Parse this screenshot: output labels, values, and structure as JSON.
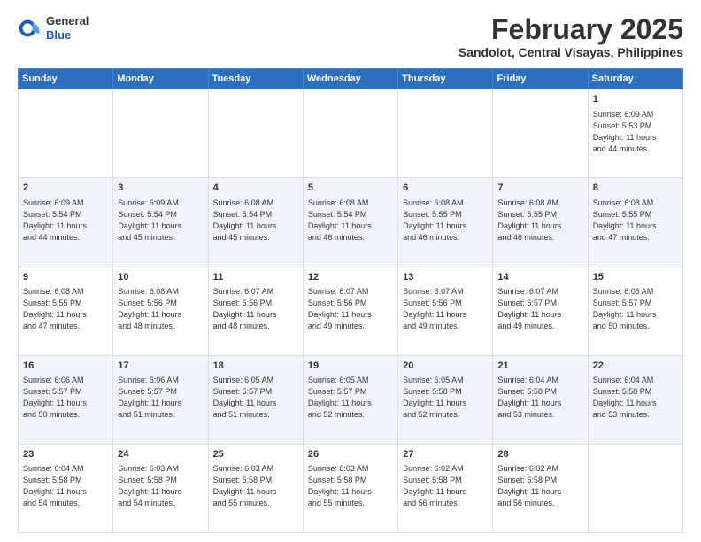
{
  "header": {
    "logo_general": "General",
    "logo_blue": "Blue",
    "month_title": "February 2025",
    "location": "Sandolot, Central Visayas, Philippines"
  },
  "days_of_week": [
    "Sunday",
    "Monday",
    "Tuesday",
    "Wednesday",
    "Thursday",
    "Friday",
    "Saturday"
  ],
  "weeks": [
    [
      {
        "day": "",
        "info": ""
      },
      {
        "day": "",
        "info": ""
      },
      {
        "day": "",
        "info": ""
      },
      {
        "day": "",
        "info": ""
      },
      {
        "day": "",
        "info": ""
      },
      {
        "day": "",
        "info": ""
      },
      {
        "day": "1",
        "info": "Sunrise: 6:09 AM\nSunset: 5:53 PM\nDaylight: 11 hours\nand 44 minutes."
      }
    ],
    [
      {
        "day": "2",
        "info": "Sunrise: 6:09 AM\nSunset: 5:54 PM\nDaylight: 11 hours\nand 44 minutes."
      },
      {
        "day": "3",
        "info": "Sunrise: 6:09 AM\nSunset: 5:54 PM\nDaylight: 11 hours\nand 45 minutes."
      },
      {
        "day": "4",
        "info": "Sunrise: 6:08 AM\nSunset: 5:54 PM\nDaylight: 11 hours\nand 45 minutes."
      },
      {
        "day": "5",
        "info": "Sunrise: 6:08 AM\nSunset: 5:54 PM\nDaylight: 11 hours\nand 46 minutes."
      },
      {
        "day": "6",
        "info": "Sunrise: 6:08 AM\nSunset: 5:55 PM\nDaylight: 11 hours\nand 46 minutes."
      },
      {
        "day": "7",
        "info": "Sunrise: 6:08 AM\nSunset: 5:55 PM\nDaylight: 11 hours\nand 46 minutes."
      },
      {
        "day": "8",
        "info": "Sunrise: 6:08 AM\nSunset: 5:55 PM\nDaylight: 11 hours\nand 47 minutes."
      }
    ],
    [
      {
        "day": "9",
        "info": "Sunrise: 6:08 AM\nSunset: 5:55 PM\nDaylight: 11 hours\nand 47 minutes."
      },
      {
        "day": "10",
        "info": "Sunrise: 6:08 AM\nSunset: 5:56 PM\nDaylight: 11 hours\nand 48 minutes."
      },
      {
        "day": "11",
        "info": "Sunrise: 6:07 AM\nSunset: 5:56 PM\nDaylight: 11 hours\nand 48 minutes."
      },
      {
        "day": "12",
        "info": "Sunrise: 6:07 AM\nSunset: 5:56 PM\nDaylight: 11 hours\nand 49 minutes."
      },
      {
        "day": "13",
        "info": "Sunrise: 6:07 AM\nSunset: 5:56 PM\nDaylight: 11 hours\nand 49 minutes."
      },
      {
        "day": "14",
        "info": "Sunrise: 6:07 AM\nSunset: 5:57 PM\nDaylight: 11 hours\nand 49 minutes."
      },
      {
        "day": "15",
        "info": "Sunrise: 6:06 AM\nSunset: 5:57 PM\nDaylight: 11 hours\nand 50 minutes."
      }
    ],
    [
      {
        "day": "16",
        "info": "Sunrise: 6:06 AM\nSunset: 5:57 PM\nDaylight: 11 hours\nand 50 minutes."
      },
      {
        "day": "17",
        "info": "Sunrise: 6:06 AM\nSunset: 5:57 PM\nDaylight: 11 hours\nand 51 minutes."
      },
      {
        "day": "18",
        "info": "Sunrise: 6:05 AM\nSunset: 5:57 PM\nDaylight: 11 hours\nand 51 minutes."
      },
      {
        "day": "19",
        "info": "Sunrise: 6:05 AM\nSunset: 5:57 PM\nDaylight: 11 hours\nand 52 minutes."
      },
      {
        "day": "20",
        "info": "Sunrise: 6:05 AM\nSunset: 5:58 PM\nDaylight: 11 hours\nand 52 minutes."
      },
      {
        "day": "21",
        "info": "Sunrise: 6:04 AM\nSunset: 5:58 PM\nDaylight: 11 hours\nand 53 minutes."
      },
      {
        "day": "22",
        "info": "Sunrise: 6:04 AM\nSunset: 5:58 PM\nDaylight: 11 hours\nand 53 minutes."
      }
    ],
    [
      {
        "day": "23",
        "info": "Sunrise: 6:04 AM\nSunset: 5:58 PM\nDaylight: 11 hours\nand 54 minutes."
      },
      {
        "day": "24",
        "info": "Sunrise: 6:03 AM\nSunset: 5:58 PM\nDaylight: 11 hours\nand 54 minutes."
      },
      {
        "day": "25",
        "info": "Sunrise: 6:03 AM\nSunset: 5:58 PM\nDaylight: 11 hours\nand 55 minutes."
      },
      {
        "day": "26",
        "info": "Sunrise: 6:03 AM\nSunset: 5:58 PM\nDaylight: 11 hours\nand 55 minutes."
      },
      {
        "day": "27",
        "info": "Sunrise: 6:02 AM\nSunset: 5:58 PM\nDaylight: 11 hours\nand 56 minutes."
      },
      {
        "day": "28",
        "info": "Sunrise: 6:02 AM\nSunset: 5:58 PM\nDaylight: 11 hours\nand 56 minutes."
      },
      {
        "day": "",
        "info": ""
      }
    ]
  ]
}
